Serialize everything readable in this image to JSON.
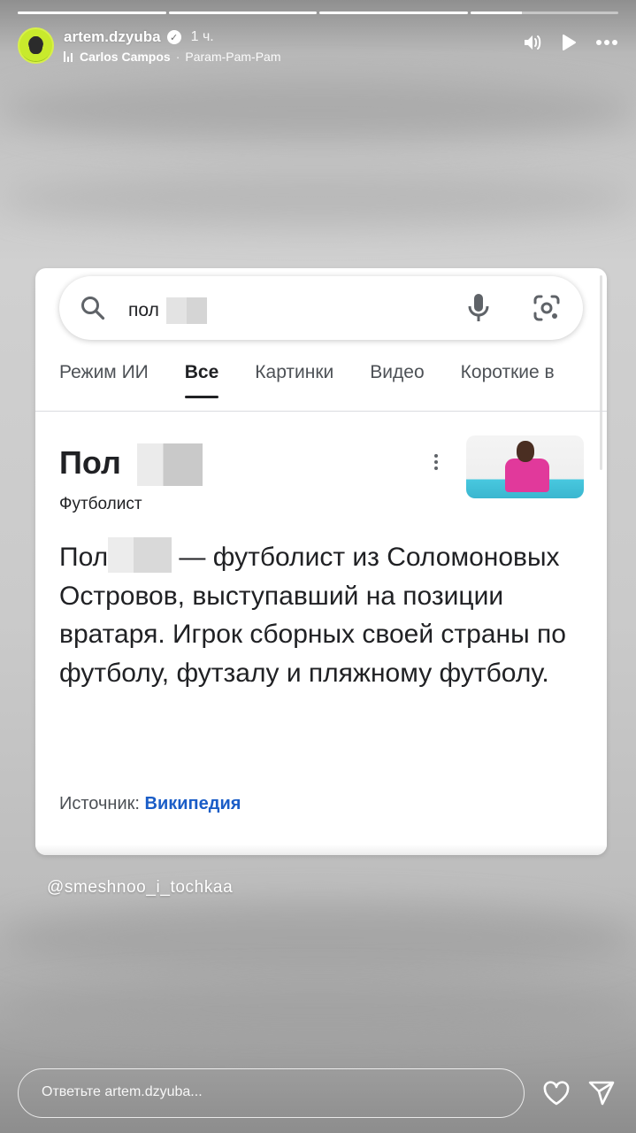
{
  "story": {
    "segments": [
      1,
      1,
      1,
      0.35
    ]
  },
  "header": {
    "username": "artem.dzyuba",
    "verified_mark": "✓",
    "time_ago": "1 ч.",
    "music_artist": "Carlos Campos",
    "music_separator": "·",
    "music_title": "Param-Pam-Pam",
    "icons": [
      "sound-icon",
      "play-icon",
      "more-icon"
    ]
  },
  "search": {
    "query": "пол"
  },
  "tabs": [
    "Режим ИИ",
    "Все",
    "Картинки",
    "Видео",
    "Короткие в"
  ],
  "active_tab_index": 1,
  "knowledge_panel": {
    "title": "Пол",
    "subtitle": "Футболист",
    "desc_start": "Пол",
    "desc_rest": " — футболист из Соломоновых Островов, выступавший на позиции вратаря. Игрок сборных своей страны по футболу, футзалу и пляжному футболу.",
    "source_label": "Источник:",
    "source_link": "Википедия"
  },
  "watermark": "@smeshnoo_i_tochkaa",
  "reply": {
    "placeholder": "Ответьте artem.dzyuba..."
  },
  "colors": {
    "link": "#1a5dc7",
    "avatar_ring": "#d8f04a",
    "thumb_shirt": "#e1399b",
    "thumb_floor": "#48c8df"
  }
}
